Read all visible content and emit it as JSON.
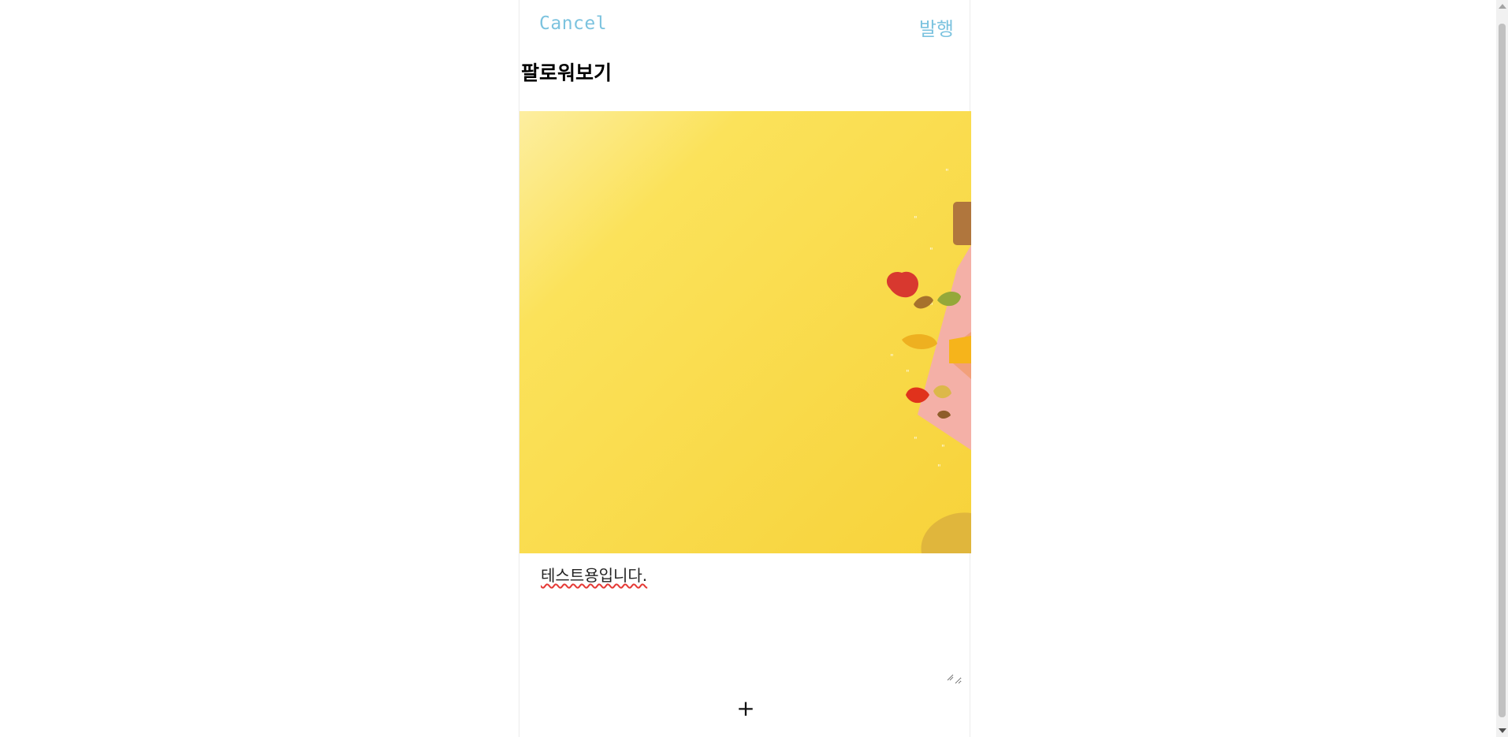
{
  "header": {
    "cancel_label": "Cancel",
    "publish_label": "발행"
  },
  "post": {
    "title": "팔로워보기",
    "body_text": "테스트용입니다."
  },
  "actions": {
    "add_label": "+"
  },
  "colors": {
    "accent": "#7cc3df",
    "image_base": "#fbe04e"
  }
}
